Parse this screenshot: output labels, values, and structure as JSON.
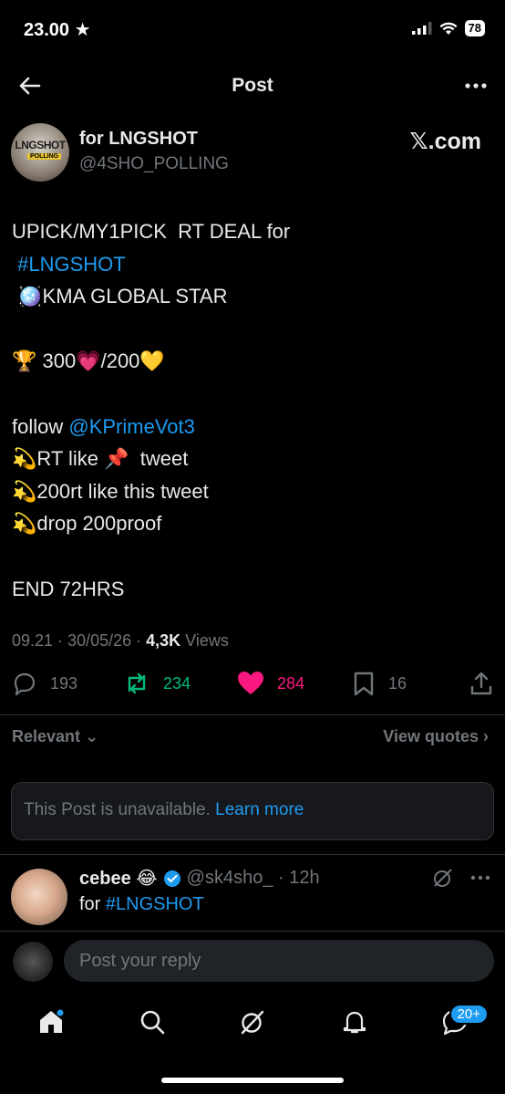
{
  "status_bar": {
    "time": "23.00",
    "battery": "78"
  },
  "header": {
    "title": "Post"
  },
  "post": {
    "author_name": "for LNGSHOT",
    "author_handle": "@4SHO_POLLING",
    "source_label": "𝕏.com",
    "avatar_text": "LNGSHOT",
    "avatar_sub": "POLLING",
    "lines": {
      "l1": "UPICK/MY1PICK  RT DEAL for",
      "l2_link": "#LNGSHOT",
      "l3": "🪩KMA GLOBAL STAR",
      "l5": "🏆 300💗/200💛",
      "l7_prefix": "follow ",
      "l7_link": "@KPrimeVot3",
      "l8": "💫RT like 📌  tweet",
      "l9": "💫200rt like this tweet",
      "l10": "💫drop 200proof",
      "l12": "END 72HRS"
    },
    "timestamp": "09.21 · 30/05/26 · ",
    "views_count": "4,3K",
    "views_label": " Views",
    "replies": "193",
    "reposts": "234",
    "likes": "284",
    "bookmarks": "16"
  },
  "replies_section": {
    "sort_label": "Relevant",
    "view_quotes": "View quotes",
    "unavailable_text": "This Post is unavailable. ",
    "learn_more": "Learn more"
  },
  "reply": {
    "name": "cebee 😂",
    "handle_time": "@sk4sho_ · 12h",
    "text_prefix": "for ",
    "text_link": "#LNGSHOT"
  },
  "compose": {
    "placeholder": "Post your reply"
  },
  "tabbar": {
    "messages_badge": "20+"
  },
  "colors": {
    "accent": "#1d9bf0",
    "repost": "#00ba7c",
    "like": "#f91880",
    "muted": "#71767b"
  }
}
